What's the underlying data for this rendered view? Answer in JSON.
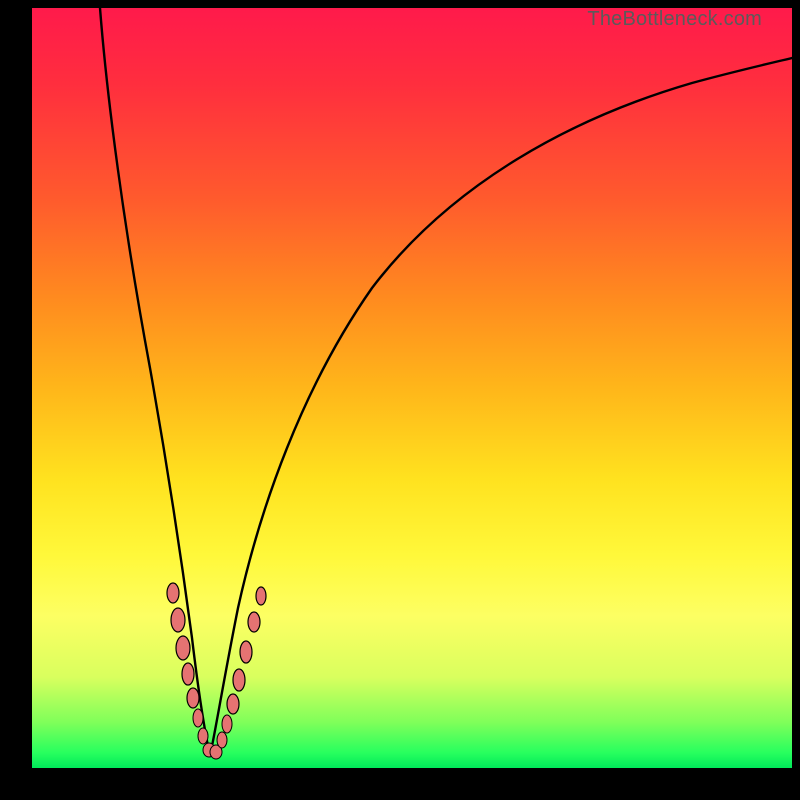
{
  "watermark": "TheBottleneck.com",
  "colors": {
    "frame": "#000000",
    "gradient_top": "#ff1a4b",
    "gradient_bottom": "#00e95a",
    "curve": "#000000",
    "bead_fill": "#e57372"
  },
  "chart_data": {
    "type": "line",
    "title": "",
    "xlabel": "",
    "ylabel": "",
    "xlim": [
      0,
      100
    ],
    "ylim": [
      0,
      100
    ],
    "grid": false,
    "legend": false,
    "series": [
      {
        "name": "left-branch",
        "x": [
          9,
          10,
          11,
          12,
          13,
          14,
          15,
          16,
          17,
          18,
          19,
          20,
          21,
          22
        ],
        "y": [
          100,
          85,
          72,
          60,
          50,
          41,
          33,
          26,
          20,
          15,
          10,
          6,
          3,
          1
        ]
      },
      {
        "name": "right-branch",
        "x": [
          22,
          23,
          24,
          25,
          27,
          30,
          35,
          40,
          45,
          50,
          55,
          60,
          65,
          70,
          75,
          80,
          85,
          90,
          95,
          100
        ],
        "y": [
          1,
          3,
          6,
          10,
          17,
          27,
          40,
          50,
          58,
          64,
          69,
          73,
          77,
          80,
          82,
          84,
          86,
          87,
          88,
          89
        ]
      }
    ],
    "highlight_points": [
      {
        "x": 18.0,
        "y": 23
      },
      {
        "x": 18.5,
        "y": 19
      },
      {
        "x": 19.0,
        "y": 15
      },
      {
        "x": 19.6,
        "y": 11
      },
      {
        "x": 20.2,
        "y": 8
      },
      {
        "x": 20.8,
        "y": 5.5
      },
      {
        "x": 21.4,
        "y": 3.5
      },
      {
        "x": 22.0,
        "y": 2.2
      },
      {
        "x": 22.6,
        "y": 2.0
      },
      {
        "x": 23.2,
        "y": 2.5
      },
      {
        "x": 23.8,
        "y": 4.0
      },
      {
        "x": 24.4,
        "y": 6.0
      },
      {
        "x": 25.0,
        "y": 8.5
      },
      {
        "x": 25.8,
        "y": 12
      },
      {
        "x": 26.6,
        "y": 16
      },
      {
        "x": 27.4,
        "y": 20
      },
      {
        "x": 28.2,
        "y": 24
      }
    ]
  }
}
